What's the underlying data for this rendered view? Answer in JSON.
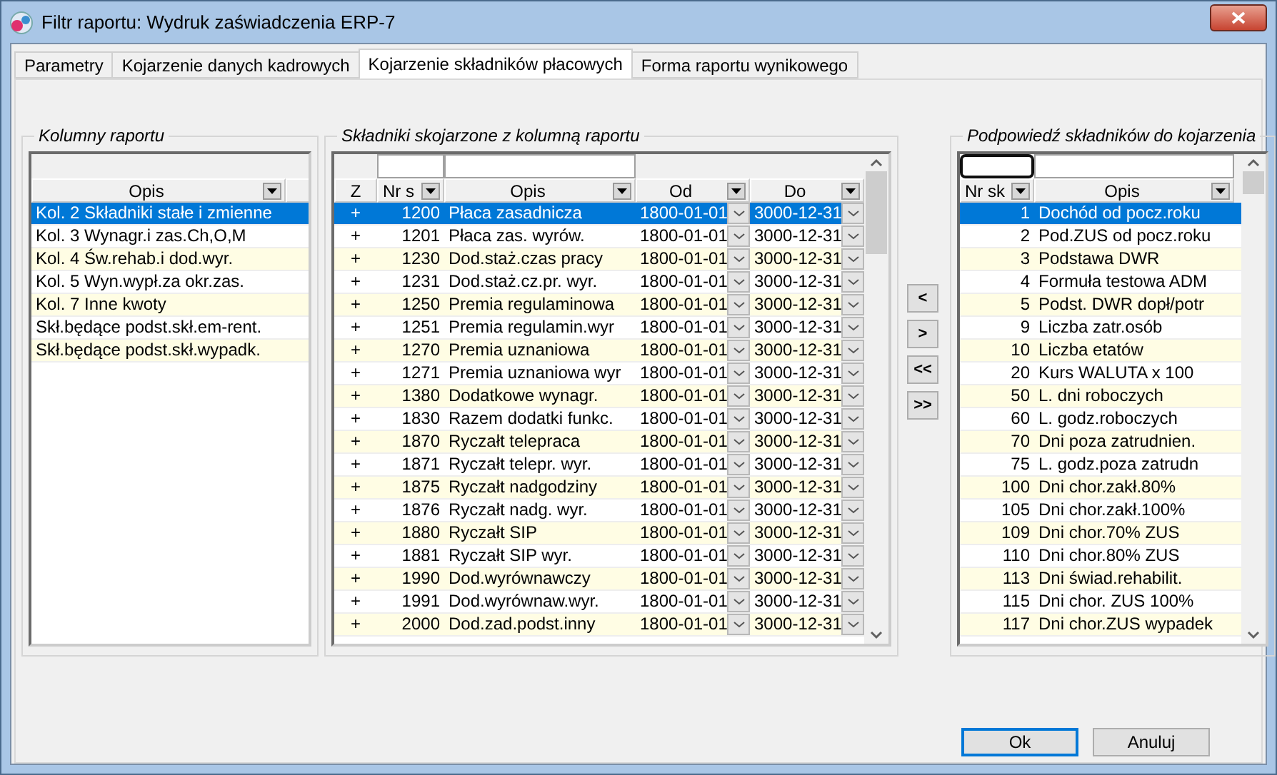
{
  "window": {
    "title": "Filtr raportu: Wydruk zaświadczenia ERP-7"
  },
  "tabs": [
    {
      "label": "Parametry",
      "selected": false
    },
    {
      "label": "Kojarzenie danych kadrowych",
      "selected": false
    },
    {
      "label": "Kojarzenie składników płacowych",
      "selected": true
    },
    {
      "label": "Forma raportu wynikowego",
      "selected": false
    }
  ],
  "left_panel": {
    "title": "Kolumny raportu",
    "columns": [
      "Opis"
    ],
    "rows": [
      {
        "text": "Kol. 2 Składniki stałe i zmienne",
        "selected": true
      },
      {
        "text": "Kol. 3 Wynagr.i zas.Ch,O,M",
        "selected": false
      },
      {
        "text": "Kol. 4 Św.rehab.i dod.wyr.",
        "selected": false
      },
      {
        "text": "Kol. 5 Wyn.wypł.za okr.zas.",
        "selected": false
      },
      {
        "text": "Kol. 7 Inne kwoty",
        "selected": false
      },
      {
        "text": "Skł.będące podst.skł.em-rent.",
        "selected": false
      },
      {
        "text": "Skł.będące podst.skł.wypadk.",
        "selected": false
      }
    ]
  },
  "middle_panel": {
    "title": "Składniki skojarzone z kolumną raportu",
    "columns": [
      "Z",
      "Nr s",
      "Opis",
      "Od",
      "Do"
    ],
    "rows": [
      {
        "z": "+",
        "nr": "1200",
        "opis": "Płaca zasadnicza",
        "od": "1800-01-01",
        "do": "3000-12-31",
        "selected": true
      },
      {
        "z": "+",
        "nr": "1201",
        "opis": "Płaca zas. wyrów.",
        "od": "1800-01-01",
        "do": "3000-12-31",
        "selected": false
      },
      {
        "z": "+",
        "nr": "1230",
        "opis": "Dod.staż.czas pracy",
        "od": "1800-01-01",
        "do": "3000-12-31",
        "selected": false
      },
      {
        "z": "+",
        "nr": "1231",
        "opis": "Dod.staż.cz.pr. wyr.",
        "od": "1800-01-01",
        "do": "3000-12-31",
        "selected": false
      },
      {
        "z": "+",
        "nr": "1250",
        "opis": "Premia regulaminowa",
        "od": "1800-01-01",
        "do": "3000-12-31",
        "selected": false
      },
      {
        "z": "+",
        "nr": "1251",
        "opis": "Premia regulamin.wyr",
        "od": "1800-01-01",
        "do": "3000-12-31",
        "selected": false
      },
      {
        "z": "+",
        "nr": "1270",
        "opis": "Premia uznaniowa",
        "od": "1800-01-01",
        "do": "3000-12-31",
        "selected": false
      },
      {
        "z": "+",
        "nr": "1271",
        "opis": "Premia uznaniowa wyr",
        "od": "1800-01-01",
        "do": "3000-12-31",
        "selected": false
      },
      {
        "z": "+",
        "nr": "1380",
        "opis": "Dodatkowe wynagr.",
        "od": "1800-01-01",
        "do": "3000-12-31",
        "selected": false
      },
      {
        "z": "+",
        "nr": "1830",
        "opis": "Razem dodatki funkc.",
        "od": "1800-01-01",
        "do": "3000-12-31",
        "selected": false
      },
      {
        "z": "+",
        "nr": "1870",
        "opis": "Ryczałt telepraca",
        "od": "1800-01-01",
        "do": "3000-12-31",
        "selected": false
      },
      {
        "z": "+",
        "nr": "1871",
        "opis": "Ryczałt telepr. wyr.",
        "od": "1800-01-01",
        "do": "3000-12-31",
        "selected": false
      },
      {
        "z": "+",
        "nr": "1875",
        "opis": "Ryczałt nadgodziny",
        "od": "1800-01-01",
        "do": "3000-12-31",
        "selected": false
      },
      {
        "z": "+",
        "nr": "1876",
        "opis": "Ryczałt nadg. wyr.",
        "od": "1800-01-01",
        "do": "3000-12-31",
        "selected": false
      },
      {
        "z": "+",
        "nr": "1880",
        "opis": "Ryczałt SIP",
        "od": "1800-01-01",
        "do": "3000-12-31",
        "selected": false
      },
      {
        "z": "+",
        "nr": "1881",
        "opis": "Ryczałt SIP wyr.",
        "od": "1800-01-01",
        "do": "3000-12-31",
        "selected": false
      },
      {
        "z": "+",
        "nr": "1990",
        "opis": "Dod.wyrównawczy",
        "od": "1800-01-01",
        "do": "3000-12-31",
        "selected": false
      },
      {
        "z": "+",
        "nr": "1991",
        "opis": "Dod.wyrównaw.wyr.",
        "od": "1800-01-01",
        "do": "3000-12-31",
        "selected": false
      },
      {
        "z": "+",
        "nr": "2000",
        "opis": "Dod.zad.podst.inny",
        "od": "1800-01-01",
        "do": "3000-12-31",
        "selected": false
      }
    ]
  },
  "arrow_buttons": [
    "<",
    ">",
    "<<",
    ">>"
  ],
  "right_panel": {
    "title": "Podpowiedź składników do kojarzenia",
    "columns": [
      "Nr sk",
      "Opis"
    ],
    "rows": [
      {
        "nr": "1",
        "opis": "Dochód od pocz.roku",
        "selected": true
      },
      {
        "nr": "2",
        "opis": "Pod.ZUS od pocz.roku",
        "selected": false
      },
      {
        "nr": "3",
        "opis": "Podstawa DWR",
        "selected": false
      },
      {
        "nr": "4",
        "opis": "Formuła testowa ADM",
        "selected": false
      },
      {
        "nr": "5",
        "opis": "Podst. DWR dopł/potr",
        "selected": false
      },
      {
        "nr": "9",
        "opis": "Liczba zatr.osób",
        "selected": false
      },
      {
        "nr": "10",
        "opis": "Liczba etatów",
        "selected": false
      },
      {
        "nr": "20",
        "opis": "Kurs WALUTA  x 100",
        "selected": false
      },
      {
        "nr": "50",
        "opis": "L. dni roboczych",
        "selected": false
      },
      {
        "nr": "60",
        "opis": "L. godz.roboczych",
        "selected": false
      },
      {
        "nr": "70",
        "opis": "Dni poza zatrudnien.",
        "selected": false
      },
      {
        "nr": "75",
        "opis": "L. godz.poza zatrudn",
        "selected": false
      },
      {
        "nr": "100",
        "opis": "Dni chor.zakł.80%",
        "selected": false
      },
      {
        "nr": "105",
        "opis": "Dni chor.zakł.100%",
        "selected": false
      },
      {
        "nr": "109",
        "opis": "Dni chor.70% ZUS",
        "selected": false
      },
      {
        "nr": "110",
        "opis": "Dni chor.80% ZUS",
        "selected": false
      },
      {
        "nr": "113",
        "opis": "Dni świad.rehabilit.",
        "selected": false
      },
      {
        "nr": "115",
        "opis": "Dni chor. ZUS  100%",
        "selected": false
      },
      {
        "nr": "117",
        "opis": "Dni chor.ZUS wypadek",
        "selected": false
      }
    ]
  },
  "buttons": [
    {
      "label": "Ok",
      "default": true
    },
    {
      "label": "Anuluj",
      "default": false
    }
  ]
}
